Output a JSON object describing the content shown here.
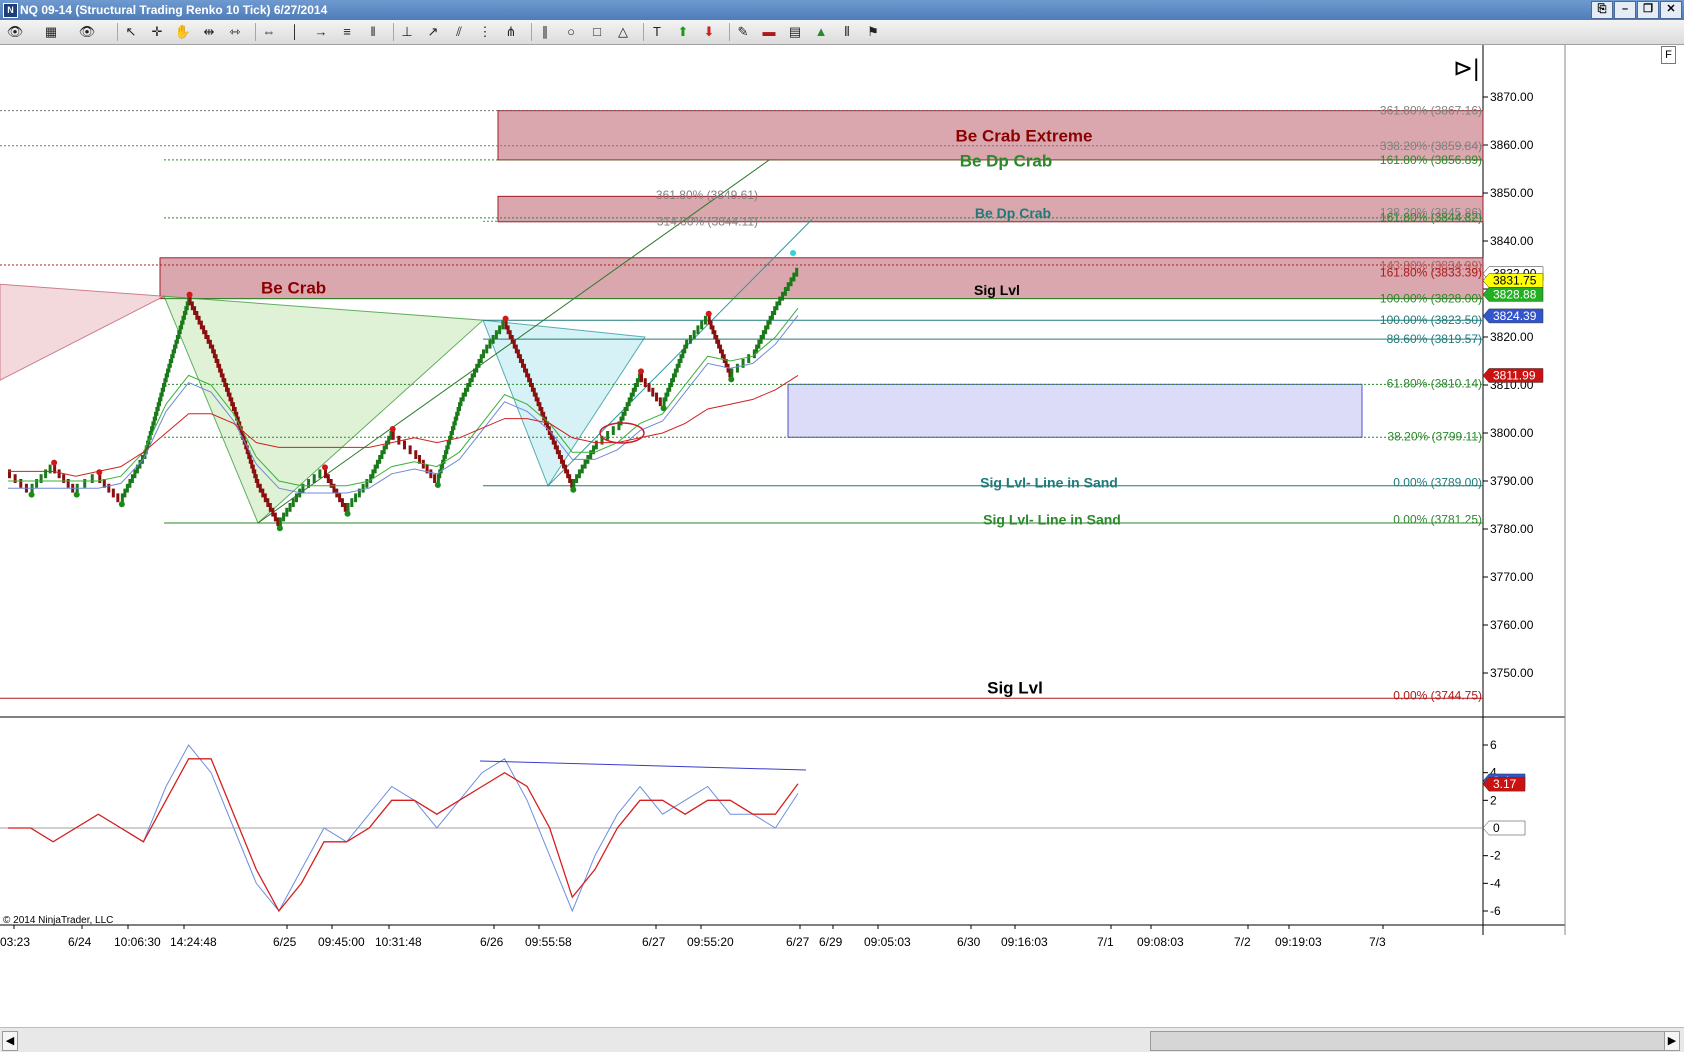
{
  "window": {
    "title": "NQ 09-14 (Structural Trading Renko 10 Tick)  6/27/2014",
    "buttons": [
      "⎘",
      "–",
      "❐",
      "✕"
    ]
  },
  "toolbar": {
    "icons": [
      "eye-icon",
      "chart-style-icon",
      "eye-icon",
      "pointer-icon",
      "crosshair-icon",
      "hand-icon",
      "bar-spacing-icon",
      "bar-width-icon",
      "price-scale-icon",
      "line-icon",
      "ray-icon",
      "extended-line-icon",
      "horizontal-line-icon",
      "vertical-line-icon",
      "arrow-line-icon",
      "fibonacci-icon",
      "fib-time-icon",
      "andrews-pitchfork-icon",
      "parallel-lines-icon",
      "ellipse-icon",
      "rectangle-icon",
      "triangle-icon",
      "text-icon",
      "arrow-up-icon",
      "arrow-down-icon",
      "strategy-icon",
      "order-icon",
      "data-box-icon",
      "indicator-icon",
      "bar-type-icon",
      "alert-icon"
    ]
  },
  "chart": {
    "copyright": "© 2014 NinjaTrader, LLC",
    "f_label": "F",
    "price_axis_labels": [
      "3870.00",
      "3860.00",
      "3850.00",
      "3840.00",
      "3830.00",
      "3820.00",
      "3810.00",
      "3800.00",
      "3790.00",
      "3780.00",
      "3770.00",
      "3760.00",
      "3750.00"
    ],
    "osc_axis_labels": [
      "6",
      "4",
      "2",
      "0",
      "-2",
      "-4",
      "-6"
    ],
    "time_labels": [
      "03:23",
      "6/24",
      "10:06:30",
      "14:24:48",
      "6/25",
      "09:45:00",
      "10:31:48",
      "6/26",
      "09:55:58",
      "6/27",
      "09:55:20",
      "6/27",
      "6/29",
      "09:05:03",
      "6/30",
      "09:16:03",
      "7/1",
      "09:08:03",
      "7/2",
      "09:19:03",
      "7/3"
    ],
    "zone_labels": {
      "be_crab_extreme": "Be Crab Extreme",
      "be_dp_crab_top": "Be Dp Crab",
      "be_dp_crab_mid": "Be Dp Crab",
      "be_crab": "Be Crab",
      "sig_lvl_upper": "Sig Lvl",
      "sig_line_sand_1": "Sig Lvl- Line in Sand",
      "sig_line_sand_2": "Sig Lvl- Line in Sand",
      "sig_lvl_bottom": "Sig Lvl"
    },
    "fib_labels": {
      "f3867": "361.80% (3867.16)",
      "f3859": "338.20% (3859.84)",
      "f3856": "161.80% (3856.89)",
      "f3849": "361.80% (3849.61)",
      "f3844m": "314.00% (3844.11)",
      "f3845": "138.20% (3845.86)",
      "f3844": "161.80% (3844.82)",
      "f3834": "143.80% (3834.99)",
      "f3833": "161.80% (3833.39)",
      "f3828": "100.00% (3828.00)",
      "f3823": "100.00% (3823.50)",
      "f3819": "88.60% (3819.57)",
      "f3810": "61.80% (3810.14)",
      "f3799": "38.20% (3799.11)",
      "f3789": "0.00% (3789.00)",
      "f3781": "0.00% (3781.25)",
      "f3744": "0.00% (3744.75)"
    },
    "price_markers": {
      "top": "3832.00",
      "last": "3831.75",
      "green": "3828.88",
      "blue": "3824.39",
      "red": "3811.99"
    },
    "osc_markers": {
      "blue": "3.4",
      "red": "3.17",
      "zero": "0"
    },
    "colors": {
      "crab_zone_fill": "#d9a7ad",
      "crab_zone_border": "#9e1c2a",
      "blue_zone_fill": "#dcdcf8",
      "blue_zone_border": "#5050c8",
      "up_bar": "#1a7a1a",
      "down_bar": "#8a1010",
      "dark_red_text": "#8b0000",
      "green_text": "#2a8a2a",
      "teal_text": "#1f7a7a",
      "last_price_bg": "#ffff00",
      "green_marker_bg": "#22b022",
      "blue_marker_bg": "#3355cc",
      "red_marker_bg": "#cc1111"
    }
  },
  "chart_data": {
    "type": "line",
    "title": "NQ 09-14 (Structural Trading Renko 10 Tick)  6/27/2014",
    "series": [
      {
        "values": [
          3792,
          3788,
          3793,
          3788,
          3791,
          3786,
          3795,
          3812,
          3828,
          3818,
          3805,
          3790,
          3781,
          3788,
          3792,
          3784,
          3790,
          3800,
          3796,
          3790,
          3806,
          3816,
          3823,
          3812,
          3800,
          3789,
          3797,
          3801,
          3812,
          3806,
          3818,
          3824,
          3812,
          3816,
          3826,
          3834
        ]
      },
      {
        "values": [
          3790,
          3790,
          3790,
          3790,
          3790,
          3791,
          3796,
          3806,
          3812,
          3810,
          3804,
          3795,
          3790,
          3789,
          3789,
          3789,
          3790,
          3793,
          3794,
          3793,
          3796,
          3802,
          3808,
          3806,
          3802,
          3796,
          3796,
          3798,
          3802,
          3804,
          3810,
          3816,
          3815,
          3816,
          3820,
          3826
        ]
      },
      {
        "values": [
          3792,
          3792,
          3792,
          3791,
          3792,
          3793,
          3796,
          3800,
          3804,
          3804,
          3802,
          3798,
          3797,
          3797,
          3797,
          3797,
          3797,
          3798,
          3799,
          3798,
          3799,
          3801,
          3803,
          3803,
          3802,
          3799,
          3798,
          3798,
          3799,
          3800,
          3802,
          3805,
          3806,
          3807,
          3809,
          3812
        ]
      }
    ],
    "oscillator": [
      {
        "values": [
          0,
          0,
          -1,
          0,
          1,
          0,
          -1,
          3,
          6,
          4,
          0,
          -4,
          -6,
          -3,
          0,
          -1,
          1,
          3,
          2,
          0,
          2,
          4,
          5,
          2,
          -2,
          -6,
          -2,
          1,
          3,
          1,
          2,
          3,
          1,
          1,
          0,
          2.5
        ]
      },
      {
        "values": [
          0,
          0,
          -1,
          0,
          1,
          0,
          -1,
          2,
          5,
          5,
          1,
          -3,
          -6,
          -4,
          -1,
          -1,
          0,
          2,
          2,
          1,
          2,
          3,
          4,
          3,
          0,
          -5,
          -3,
          0,
          2,
          2,
          1,
          2,
          2,
          1,
          1,
          3.2
        ]
      }
    ],
    "ylim": [
      3740,
      3875
    ],
    "osc_ylim": [
      -7,
      7
    ]
  }
}
